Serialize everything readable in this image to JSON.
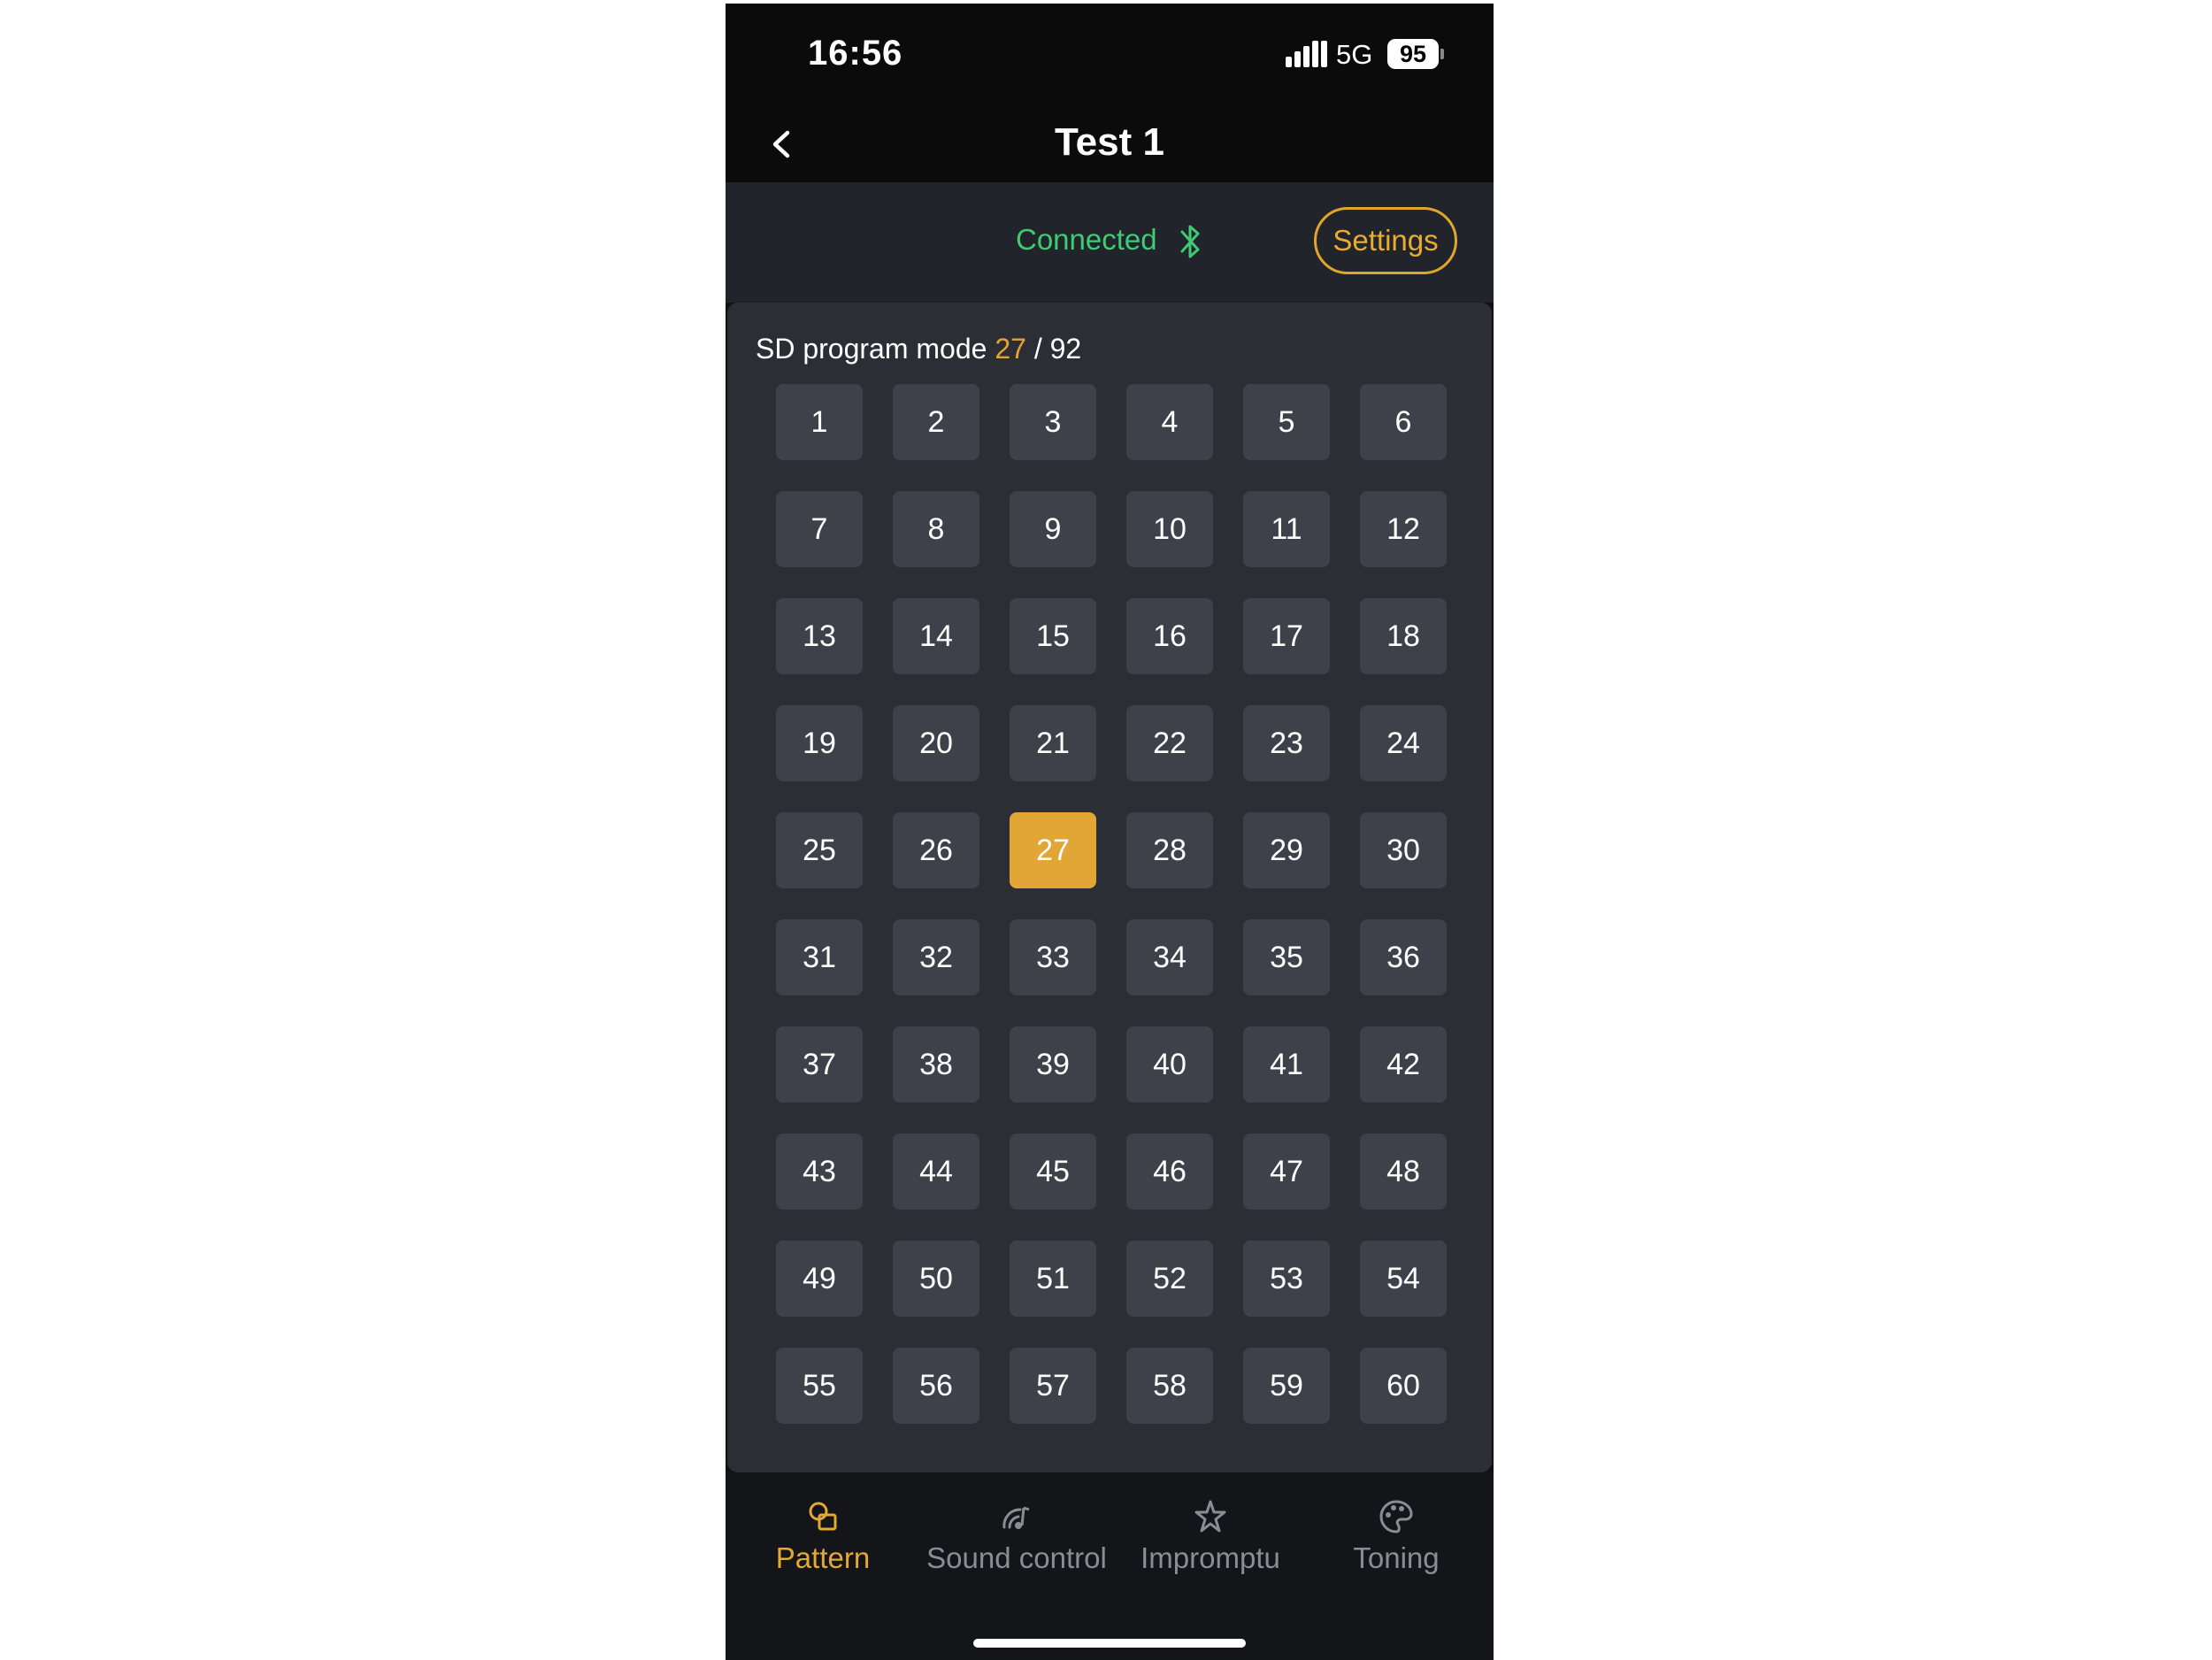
{
  "status_bar": {
    "time": "16:56",
    "network": "5G",
    "battery": "95"
  },
  "header": {
    "title": "Test 1"
  },
  "connection": {
    "status": "Connected",
    "settings_label": "Settings"
  },
  "program": {
    "mode_label": "SD program mode",
    "current": "27",
    "separator": "/",
    "total": "92"
  },
  "programs": [
    "1",
    "2",
    "3",
    "4",
    "5",
    "6",
    "7",
    "8",
    "9",
    "10",
    "11",
    "12",
    "13",
    "14",
    "15",
    "16",
    "17",
    "18",
    "19",
    "20",
    "21",
    "22",
    "23",
    "24",
    "25",
    "26",
    "27",
    "28",
    "29",
    "30",
    "31",
    "32",
    "33",
    "34",
    "35",
    "36",
    "37",
    "38",
    "39",
    "40",
    "41",
    "42",
    "43",
    "44",
    "45",
    "46",
    "47",
    "48",
    "49",
    "50",
    "51",
    "52",
    "53",
    "54",
    "55",
    "56",
    "57",
    "58",
    "59",
    "60"
  ],
  "selected_program": "27",
  "tabs": [
    {
      "label": "Pattern",
      "icon": "pattern-icon",
      "active": true
    },
    {
      "label": "Sound control",
      "icon": "sound-control-icon",
      "active": false
    },
    {
      "label": "Impromptu",
      "icon": "impromptu-icon",
      "active": false
    },
    {
      "label": "Toning",
      "icon": "toning-icon",
      "active": false
    }
  ],
  "colors": {
    "accent": "#e2a636",
    "connected": "#3dcb73",
    "cell": "#3e4149",
    "panel": "#2c2e35"
  }
}
